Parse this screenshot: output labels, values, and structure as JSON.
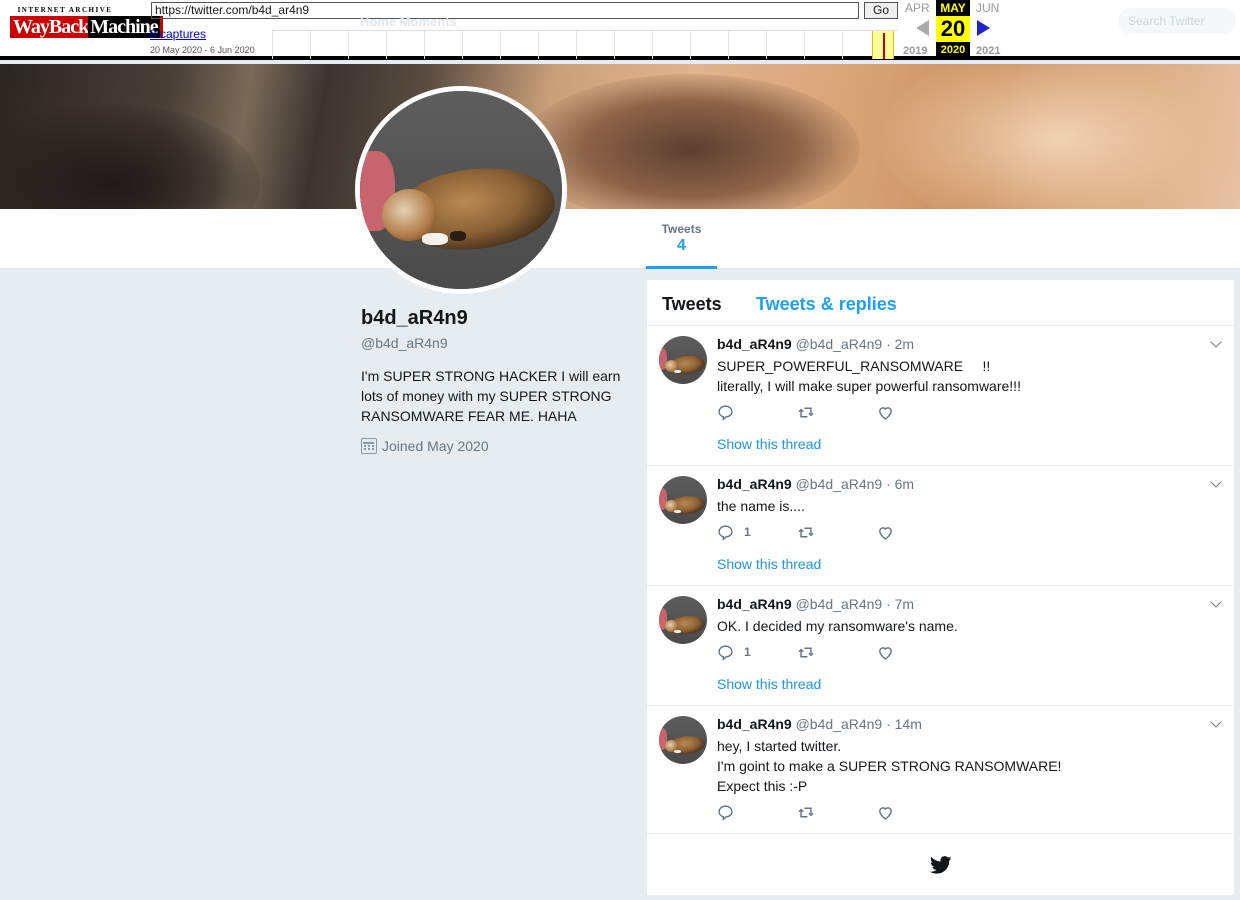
{
  "wayback": {
    "logo_top": "INTERNET ARCHIVE",
    "logo_wayback": "WayBack",
    "logo_machine": "Machine",
    "url": "https://twitter.com/b4d_ar4n9",
    "go_label": "Go",
    "captures": "8 captures",
    "range": "20 May 2020 - 6 Jun 2020",
    "prev_month": "APR",
    "cur_month": "MAY",
    "next_month": "JUN",
    "cur_day": "20",
    "prev_year": "2019",
    "cur_year": "2020",
    "next_year": "2021"
  },
  "twitter_header": {
    "search_placeholder": "Search Twitter",
    "ghost_nav": "Home      Moments"
  },
  "nav": {
    "tweets_label": "Tweets",
    "tweets_count": "4"
  },
  "profile": {
    "name": "b4d_aR4n9",
    "handle": "@b4d_aR4n9",
    "bio": "I'm SUPER STRONG HACKER I will earn lots of money with my SUPER STRONG RANSOMWARE FEAR ME. HAHA",
    "joined": "Joined May 2020"
  },
  "timeline": {
    "tab_tweets": "Tweets",
    "tab_replies": "Tweets & replies",
    "tweets": [
      {
        "name": "b4d_aR4n9",
        "meta": "@b4d_aR4n9 · 2m",
        "text_lines": [
          "SUPER_POWERFUL_RANSOMWARE     !!",
          "literally, I will make super powerful ransomware!!!"
        ],
        "reply_count": "",
        "thread": "Show this thread"
      },
      {
        "name": "b4d_aR4n9",
        "meta": "@b4d_aR4n9 · 6m",
        "text_lines": [
          "the name is...."
        ],
        "reply_count": "1",
        "thread": "Show this thread"
      },
      {
        "name": "b4d_aR4n9",
        "meta": "@b4d_aR4n9 · 7m",
        "text_lines": [
          "OK. I decided my ransomware's name."
        ],
        "reply_count": "1",
        "thread": "Show this thread"
      },
      {
        "name": "b4d_aR4n9",
        "meta": "@b4d_aR4n9 · 14m",
        "text_lines": [
          "hey, I started twitter.",
          "I'm goint to make a SUPER STRONG RANSOMWARE!",
          "Expect this :-P"
        ],
        "reply_count": "",
        "thread": ""
      }
    ]
  },
  "colors": {
    "accent": "#1da1f2",
    "link": "#1b95e0",
    "page_bg": "#e6ecf0",
    "muted": "#657786"
  }
}
